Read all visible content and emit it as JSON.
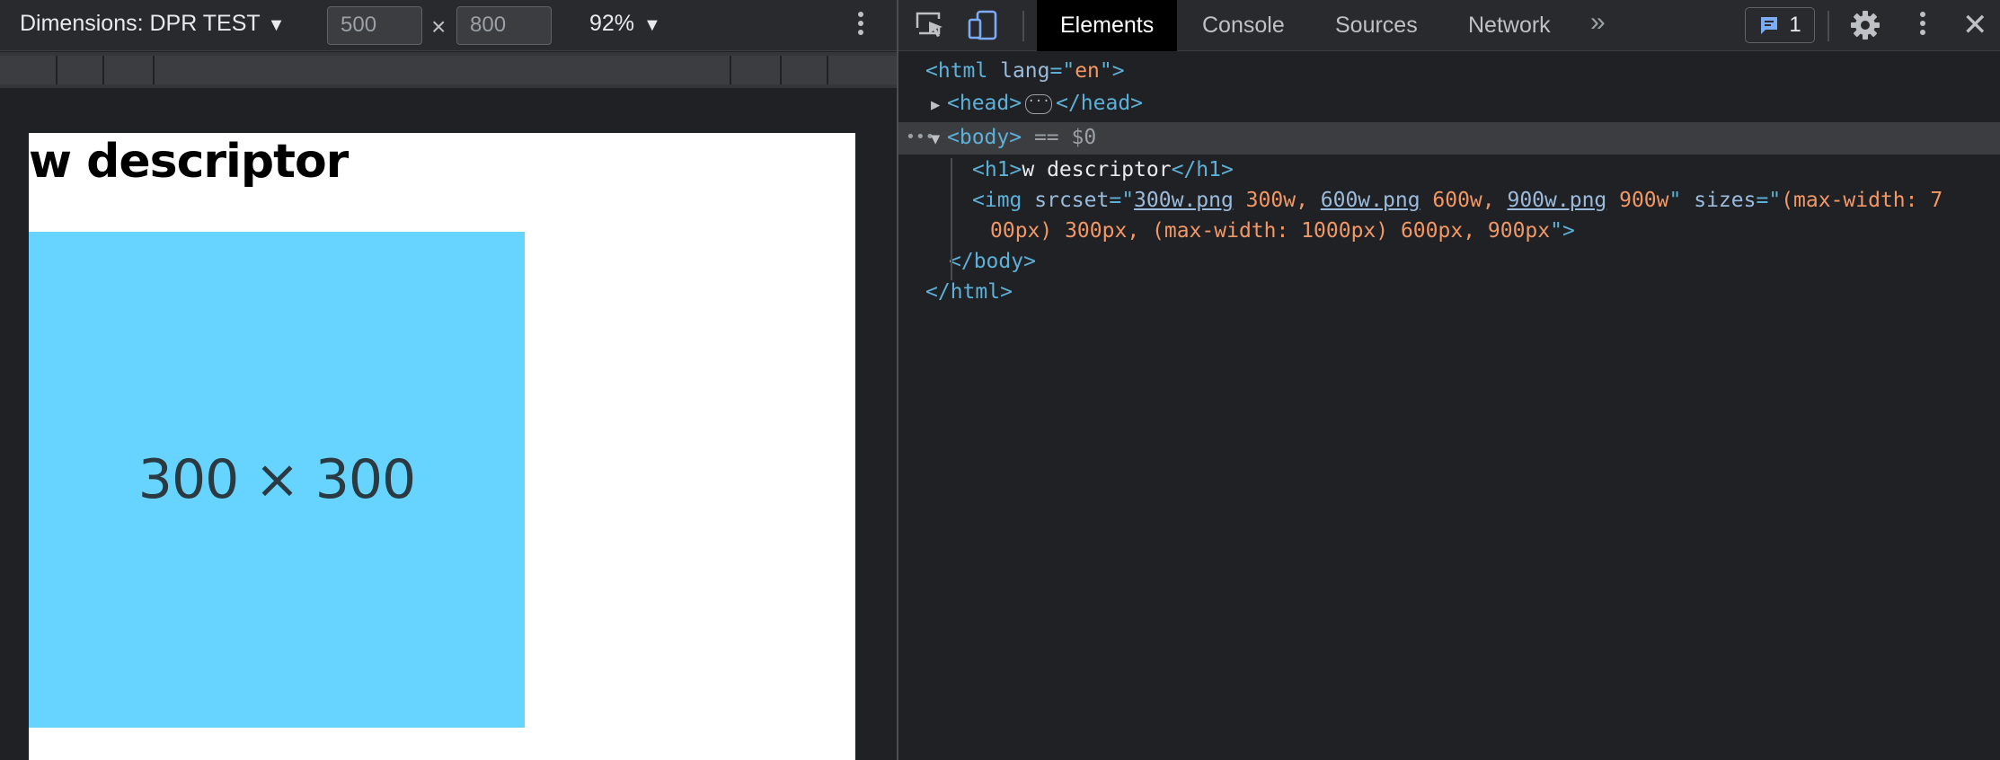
{
  "device_toolbar": {
    "dimensions_label": "Dimensions: DPR TEST",
    "width_value": "500",
    "height_value": "800",
    "times_symbol": "×",
    "zoom": "92%",
    "caret": "▼"
  },
  "page": {
    "heading": "w descriptor",
    "image_label": "300 × 300",
    "image_color": "#66d4ff"
  },
  "devtools": {
    "tabs": [
      {
        "label": "Elements",
        "active": true
      },
      {
        "label": "Console"
      },
      {
        "label": "Sources"
      },
      {
        "label": "Network"
      }
    ],
    "more_tabs": "»",
    "issues_count": "1",
    "close": "✕"
  },
  "dom": {
    "html_open": "<html",
    "lang_attr": "lang",
    "lang_eq": "=\"",
    "lang_val": "en",
    "lang_close": "\">",
    "head": "<head>",
    "head_ellipsis": "···",
    "head_close": "</head>",
    "body_open": "<body>",
    "body_selected": "== $0",
    "h1_open": "<h1>",
    "h1_text": "w descriptor",
    "h1_close": "</h1>",
    "img_open": "<img",
    "srcset_attr": "srcset",
    "q_open": "=\"",
    "src1": "300w.png",
    "src1_w": " 300w, ",
    "src2": "600w.png",
    "src2_w": " 600w, ",
    "src3": "900w.png",
    "src3_w": " 900w",
    "q_close": "\"",
    "sizes_attr": "sizes",
    "sizes_val_1": "(max-width: 7",
    "sizes_val_2": "00px) 300px, (max-width: 1000px) 600px, 900px",
    "img_close": "\">",
    "body_close": "</body>",
    "html_close": "</html>"
  }
}
